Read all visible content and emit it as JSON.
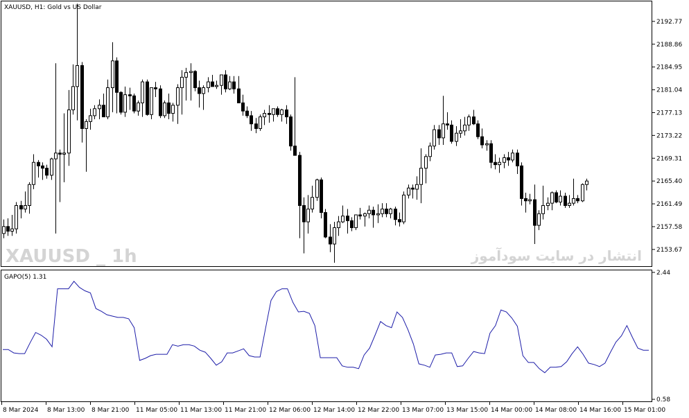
{
  "chart_data": [
    {
      "type": "candlestick",
      "title": "XAUUSD, H1:  Gold vs US Dollar",
      "watermark_left": "XAUUSD _ 1h",
      "watermark_right": "انتشار در سایت سودآموز",
      "ylim": [
        2150.8,
        2196.2
      ],
      "y_ticks": [
        "2192.77",
        "2188.86",
        "2184.95",
        "2181.04",
        "2177.13",
        "2173.22",
        "2169.31",
        "2165.40",
        "2161.49",
        "2157.58",
        "2153.67"
      ],
      "candles": [
        {
          "o": 2156.4,
          "h": 2158.8,
          "l": 2155.6,
          "c": 2157.6
        },
        {
          "o": 2157.6,
          "h": 2159.0,
          "l": 2156.0,
          "c": 2156.8
        },
        {
          "o": 2156.8,
          "h": 2159.6,
          "l": 2156.0,
          "c": 2157.2
        },
        {
          "o": 2157.2,
          "h": 2161.8,
          "l": 2156.4,
          "c": 2161.2
        },
        {
          "o": 2161.2,
          "h": 2162.0,
          "l": 2159.0,
          "c": 2160.6
        },
        {
          "o": 2160.6,
          "h": 2163.6,
          "l": 2160.0,
          "c": 2161.2
        },
        {
          "o": 2161.2,
          "h": 2165.2,
          "l": 2159.8,
          "c": 2164.8
        },
        {
          "o": 2164.8,
          "h": 2170.0,
          "l": 2164.0,
          "c": 2168.6
        },
        {
          "o": 2168.6,
          "h": 2169.0,
          "l": 2166.0,
          "c": 2168.0
        },
        {
          "o": 2168.0,
          "h": 2168.6,
          "l": 2165.6,
          "c": 2167.6
        },
        {
          "o": 2167.6,
          "h": 2168.2,
          "l": 2165.8,
          "c": 2166.4
        },
        {
          "o": 2166.4,
          "h": 2169.4,
          "l": 2165.6,
          "c": 2169.2
        },
        {
          "o": 2169.2,
          "h": 2185.6,
          "l": 2156.4,
          "c": 2170.2
        },
        {
          "o": 2170.2,
          "h": 2170.8,
          "l": 2161.8,
          "c": 2170.0
        },
        {
          "o": 2170.0,
          "h": 2177.0,
          "l": 2165.2,
          "c": 2170.2
        },
        {
          "o": 2170.2,
          "h": 2181.0,
          "l": 2168.0,
          "c": 2177.6
        },
        {
          "o": 2177.6,
          "h": 2185.4,
          "l": 2176.8,
          "c": 2181.6
        },
        {
          "o": 2181.6,
          "h": 2195.8,
          "l": 2175.8,
          "c": 2185.2
        },
        {
          "o": 2185.2,
          "h": 2185.8,
          "l": 2172.0,
          "c": 2174.4
        },
        {
          "o": 2174.4,
          "h": 2176.0,
          "l": 2167.0,
          "c": 2175.6
        },
        {
          "o": 2175.6,
          "h": 2177.8,
          "l": 2174.2,
          "c": 2176.6
        },
        {
          "o": 2176.6,
          "h": 2178.4,
          "l": 2176.0,
          "c": 2177.8
        },
        {
          "o": 2177.8,
          "h": 2179.4,
          "l": 2176.0,
          "c": 2178.4
        },
        {
          "o": 2178.4,
          "h": 2180.4,
          "l": 2177.0,
          "c": 2176.4
        },
        {
          "o": 2176.4,
          "h": 2182.8,
          "l": 2176.0,
          "c": 2181.4
        },
        {
          "o": 2181.4,
          "h": 2189.2,
          "l": 2177.2,
          "c": 2186.0
        },
        {
          "o": 2186.0,
          "h": 2186.6,
          "l": 2177.0,
          "c": 2180.6
        },
        {
          "o": 2180.6,
          "h": 2180.8,
          "l": 2176.8,
          "c": 2177.2
        },
        {
          "o": 2177.2,
          "h": 2181.6,
          "l": 2176.4,
          "c": 2180.2
        },
        {
          "o": 2180.2,
          "h": 2181.4,
          "l": 2177.6,
          "c": 2180.0
        },
        {
          "o": 2180.0,
          "h": 2180.4,
          "l": 2177.0,
          "c": 2177.4
        },
        {
          "o": 2177.4,
          "h": 2179.2,
          "l": 2176.6,
          "c": 2178.8
        },
        {
          "o": 2178.8,
          "h": 2182.8,
          "l": 2176.4,
          "c": 2182.4
        },
        {
          "o": 2182.4,
          "h": 2182.8,
          "l": 2176.6,
          "c": 2176.8
        },
        {
          "o": 2176.8,
          "h": 2178.2,
          "l": 2176.0,
          "c": 2181.4
        },
        {
          "o": 2181.4,
          "h": 2182.4,
          "l": 2179.8,
          "c": 2181.2
        },
        {
          "o": 2181.2,
          "h": 2181.8,
          "l": 2176.2,
          "c": 2176.6
        },
        {
          "o": 2176.6,
          "h": 2179.2,
          "l": 2176.2,
          "c": 2178.8
        },
        {
          "o": 2178.8,
          "h": 2180.4,
          "l": 2176.0,
          "c": 2177.0
        },
        {
          "o": 2177.0,
          "h": 2178.8,
          "l": 2175.6,
          "c": 2178.4
        },
        {
          "o": 2178.4,
          "h": 2182.0,
          "l": 2175.2,
          "c": 2181.4
        },
        {
          "o": 2181.4,
          "h": 2184.4,
          "l": 2176.8,
          "c": 2183.2
        },
        {
          "o": 2183.2,
          "h": 2184.8,
          "l": 2179.2,
          "c": 2184.0
        },
        {
          "o": 2184.0,
          "h": 2185.6,
          "l": 2179.2,
          "c": 2184.2
        },
        {
          "o": 2184.2,
          "h": 2184.4,
          "l": 2180.8,
          "c": 2181.4
        },
        {
          "o": 2181.4,
          "h": 2182.6,
          "l": 2178.0,
          "c": 2180.4
        },
        {
          "o": 2180.4,
          "h": 2181.8,
          "l": 2177.6,
          "c": 2181.4
        },
        {
          "o": 2181.4,
          "h": 2183.2,
          "l": 2180.6,
          "c": 2182.4
        },
        {
          "o": 2182.4,
          "h": 2183.6,
          "l": 2181.6,
          "c": 2181.6
        },
        {
          "o": 2181.6,
          "h": 2182.6,
          "l": 2181.2,
          "c": 2181.8
        },
        {
          "o": 2181.8,
          "h": 2183.6,
          "l": 2180.2,
          "c": 2183.6
        },
        {
          "o": 2183.6,
          "h": 2184.4,
          "l": 2180.6,
          "c": 2181.2
        },
        {
          "o": 2181.2,
          "h": 2183.4,
          "l": 2181.0,
          "c": 2182.4
        },
        {
          "o": 2182.4,
          "h": 2183.4,
          "l": 2180.4,
          "c": 2181.2
        },
        {
          "o": 2181.2,
          "h": 2183.4,
          "l": 2179.8,
          "c": 2178.8
        },
        {
          "o": 2178.8,
          "h": 2180.2,
          "l": 2176.6,
          "c": 2177.4
        },
        {
          "o": 2177.4,
          "h": 2178.2,
          "l": 2176.2,
          "c": 2176.6
        },
        {
          "o": 2176.6,
          "h": 2177.4,
          "l": 2174.0,
          "c": 2175.2
        },
        {
          "o": 2175.2,
          "h": 2176.2,
          "l": 2173.6,
          "c": 2174.4
        },
        {
          "o": 2174.4,
          "h": 2176.8,
          "l": 2174.0,
          "c": 2176.4
        },
        {
          "o": 2176.4,
          "h": 2177.6,
          "l": 2175.0,
          "c": 2177.0
        },
        {
          "o": 2177.0,
          "h": 2178.4,
          "l": 2175.4,
          "c": 2176.8
        },
        {
          "o": 2176.8,
          "h": 2177.0,
          "l": 2175.6,
          "c": 2177.8
        },
        {
          "o": 2177.8,
          "h": 2178.2,
          "l": 2176.4,
          "c": 2176.8
        },
        {
          "o": 2176.8,
          "h": 2177.8,
          "l": 2175.6,
          "c": 2177.6
        },
        {
          "o": 2177.6,
          "h": 2178.4,
          "l": 2175.2,
          "c": 2176.4
        },
        {
          "o": 2176.4,
          "h": 2176.8,
          "l": 2170.6,
          "c": 2171.4
        },
        {
          "o": 2171.4,
          "h": 2183.2,
          "l": 2170.8,
          "c": 2169.8
        },
        {
          "o": 2169.8,
          "h": 2170.4,
          "l": 2155.6,
          "c": 2161.2
        },
        {
          "o": 2161.2,
          "h": 2162.6,
          "l": 2153.0,
          "c": 2158.4
        },
        {
          "o": 2158.4,
          "h": 2163.0,
          "l": 2156.4,
          "c": 2160.6
        },
        {
          "o": 2160.6,
          "h": 2164.6,
          "l": 2160.0,
          "c": 2162.6
        },
        {
          "o": 2162.6,
          "h": 2165.8,
          "l": 2162.0,
          "c": 2165.6
        },
        {
          "o": 2165.6,
          "h": 2166.0,
          "l": 2159.0,
          "c": 2160.0
        },
        {
          "o": 2160.0,
          "h": 2160.6,
          "l": 2155.6,
          "c": 2155.8
        },
        {
          "o": 2155.8,
          "h": 2158.0,
          "l": 2153.2,
          "c": 2154.6
        },
        {
          "o": 2154.6,
          "h": 2158.4,
          "l": 2151.4,
          "c": 2157.4
        },
        {
          "o": 2157.4,
          "h": 2159.4,
          "l": 2156.0,
          "c": 2158.4
        },
        {
          "o": 2158.4,
          "h": 2161.2,
          "l": 2158.2,
          "c": 2159.4
        },
        {
          "o": 2159.4,
          "h": 2160.6,
          "l": 2156.4,
          "c": 2158.6
        },
        {
          "o": 2158.6,
          "h": 2159.2,
          "l": 2156.8,
          "c": 2157.4
        },
        {
          "o": 2157.4,
          "h": 2158.6,
          "l": 2157.0,
          "c": 2159.6
        },
        {
          "o": 2159.6,
          "h": 2160.8,
          "l": 2158.8,
          "c": 2159.4
        },
        {
          "o": 2159.4,
          "h": 2160.0,
          "l": 2157.6,
          "c": 2159.8
        },
        {
          "o": 2159.8,
          "h": 2161.2,
          "l": 2159.0,
          "c": 2160.4
        },
        {
          "o": 2160.4,
          "h": 2161.0,
          "l": 2157.4,
          "c": 2159.6
        },
        {
          "o": 2159.6,
          "h": 2161.4,
          "l": 2158.2,
          "c": 2159.8
        },
        {
          "o": 2159.8,
          "h": 2161.6,
          "l": 2159.2,
          "c": 2160.6
        },
        {
          "o": 2160.6,
          "h": 2161.6,
          "l": 2159.2,
          "c": 2159.8
        },
        {
          "o": 2159.8,
          "h": 2160.8,
          "l": 2159.0,
          "c": 2160.6
        },
        {
          "o": 2160.6,
          "h": 2161.0,
          "l": 2157.8,
          "c": 2158.8
        },
        {
          "o": 2158.8,
          "h": 2160.0,
          "l": 2157.6,
          "c": 2158.4
        },
        {
          "o": 2158.4,
          "h": 2163.6,
          "l": 2158.0,
          "c": 2163.0
        },
        {
          "o": 2163.0,
          "h": 2164.8,
          "l": 2162.4,
          "c": 2164.2
        },
        {
          "o": 2164.2,
          "h": 2164.8,
          "l": 2162.4,
          "c": 2164.0
        },
        {
          "o": 2164.0,
          "h": 2166.2,
          "l": 2162.2,
          "c": 2164.8
        },
        {
          "o": 2164.8,
          "h": 2171.0,
          "l": 2161.6,
          "c": 2167.6
        },
        {
          "o": 2167.6,
          "h": 2170.0,
          "l": 2165.0,
          "c": 2169.6
        },
        {
          "o": 2169.6,
          "h": 2172.0,
          "l": 2168.8,
          "c": 2171.4
        },
        {
          "o": 2171.4,
          "h": 2175.0,
          "l": 2170.8,
          "c": 2174.2
        },
        {
          "o": 2174.2,
          "h": 2175.0,
          "l": 2171.6,
          "c": 2172.8
        },
        {
          "o": 2172.8,
          "h": 2180.0,
          "l": 2171.6,
          "c": 2175.2
        },
        {
          "o": 2175.2,
          "h": 2177.2,
          "l": 2174.2,
          "c": 2175.0
        },
        {
          "o": 2175.0,
          "h": 2175.8,
          "l": 2171.8,
          "c": 2172.2
        },
        {
          "o": 2172.2,
          "h": 2174.8,
          "l": 2171.4,
          "c": 2173.6
        },
        {
          "o": 2173.6,
          "h": 2176.0,
          "l": 2172.8,
          "c": 2174.0
        },
        {
          "o": 2174.0,
          "h": 2176.4,
          "l": 2173.2,
          "c": 2175.0
        },
        {
          "o": 2175.0,
          "h": 2176.8,
          "l": 2174.0,
          "c": 2176.4
        },
        {
          "o": 2176.4,
          "h": 2177.6,
          "l": 2175.0,
          "c": 2175.2
        },
        {
          "o": 2175.2,
          "h": 2175.8,
          "l": 2172.6,
          "c": 2173.0
        },
        {
          "o": 2173.0,
          "h": 2174.4,
          "l": 2171.0,
          "c": 2171.6
        },
        {
          "o": 2171.6,
          "h": 2172.4,
          "l": 2170.6,
          "c": 2171.8
        },
        {
          "o": 2171.8,
          "h": 2172.4,
          "l": 2167.6,
          "c": 2168.6
        },
        {
          "o": 2168.6,
          "h": 2170.0,
          "l": 2167.4,
          "c": 2168.2
        },
        {
          "o": 2168.2,
          "h": 2169.4,
          "l": 2166.8,
          "c": 2168.6
        },
        {
          "o": 2168.6,
          "h": 2170.0,
          "l": 2167.6,
          "c": 2169.4
        },
        {
          "o": 2169.4,
          "h": 2170.4,
          "l": 2168.0,
          "c": 2169.0
        },
        {
          "o": 2169.0,
          "h": 2170.8,
          "l": 2168.6,
          "c": 2170.2
        },
        {
          "o": 2170.2,
          "h": 2170.8,
          "l": 2166.6,
          "c": 2168.0
        },
        {
          "o": 2168.0,
          "h": 2168.6,
          "l": 2161.2,
          "c": 2162.4
        },
        {
          "o": 2162.4,
          "h": 2163.4,
          "l": 2160.0,
          "c": 2162.0
        },
        {
          "o": 2162.0,
          "h": 2163.2,
          "l": 2161.4,
          "c": 2162.2
        },
        {
          "o": 2162.2,
          "h": 2164.8,
          "l": 2154.6,
          "c": 2157.8
        },
        {
          "o": 2157.8,
          "h": 2160.4,
          "l": 2157.0,
          "c": 2159.8
        },
        {
          "o": 2159.8,
          "h": 2164.6,
          "l": 2158.8,
          "c": 2161.2
        },
        {
          "o": 2161.2,
          "h": 2162.6,
          "l": 2160.4,
          "c": 2161.6
        },
        {
          "o": 2161.6,
          "h": 2163.6,
          "l": 2160.4,
          "c": 2163.4
        },
        {
          "o": 2163.4,
          "h": 2163.8,
          "l": 2161.6,
          "c": 2161.8
        },
        {
          "o": 2161.8,
          "h": 2163.8,
          "l": 2161.2,
          "c": 2162.8
        },
        {
          "o": 2162.8,
          "h": 2163.4,
          "l": 2160.8,
          "c": 2161.2
        },
        {
          "o": 2161.2,
          "h": 2163.0,
          "l": 2160.8,
          "c": 2161.6
        },
        {
          "o": 2161.6,
          "h": 2165.8,
          "l": 2161.2,
          "c": 2162.4
        },
        {
          "o": 2162.4,
          "h": 2163.0,
          "l": 2161.6,
          "c": 2162.0
        },
        {
          "o": 2162.0,
          "h": 2165.0,
          "l": 2161.8,
          "c": 2164.8
        },
        {
          "o": 2164.8,
          "h": 2165.8,
          "l": 2163.8,
          "c": 2165.4
        }
      ]
    },
    {
      "type": "line",
      "label": "GAPO(5) 1.31",
      "ylim": [
        0.55,
        2.47
      ],
      "y_ticks": [
        "2.44",
        "0.58"
      ],
      "line_color": "#1c1ca8",
      "values": [
        1.31,
        1.31,
        1.26,
        1.25,
        1.25,
        1.41,
        1.56,
        1.52,
        1.46,
        1.35,
        2.2,
        2.2,
        2.2,
        2.31,
        2.22,
        2.17,
        2.14,
        1.91,
        1.87,
        1.82,
        1.8,
        1.78,
        1.78,
        1.76,
        1.63,
        1.15,
        1.18,
        1.22,
        1.24,
        1.24,
        1.24,
        1.38,
        1.36,
        1.38,
        1.38,
        1.36,
        1.3,
        1.27,
        1.18,
        1.08,
        1.13,
        1.26,
        1.26,
        1.29,
        1.32,
        1.22,
        1.2,
        1.2,
        1.62,
        2.03,
        2.16,
        2.2,
        2.2,
        2.0,
        1.86,
        1.87,
        1.84,
        1.66,
        1.19,
        1.19,
        1.19,
        1.19,
        1.07,
        1.05,
        1.05,
        1.03,
        1.23,
        1.33,
        1.52,
        1.72,
        1.66,
        1.63,
        1.86,
        1.78,
        1.6,
        1.39,
        1.1,
        1.08,
        1.05,
        1.23,
        1.24,
        1.26,
        1.26,
        1.06,
        1.07,
        1.18,
        1.28,
        1.26,
        1.25,
        1.55,
        1.66,
        1.89,
        1.86,
        1.77,
        1.65,
        1.22,
        1.12,
        1.12,
        1.03,
        0.97,
        1.05,
        1.05,
        1.06,
        1.13,
        1.25,
        1.35,
        1.24,
        1.11,
        1.09,
        1.06,
        1.11,
        1.27,
        1.42,
        1.51,
        1.66,
        1.49,
        1.33,
        1.3,
        1.3
      ]
    }
  ],
  "x_labels": [
    "8 Mar 2024",
    "8 Mar 13:00",
    "8 Mar 21:00",
    "11 Mar 05:00",
    "11 Mar 13:00",
    "11 Mar 21:00",
    "12 Mar 06:00",
    "12 Mar 14:00",
    "12 Mar 22:00",
    "13 Mar 07:00",
    "13 Mar 15:00",
    "14 Mar 00:00",
    "14 Mar 08:00",
    "14 Mar 16:00",
    "15 Mar 01:00"
  ],
  "colors": {
    "candle": "#000000",
    "background": "#ffffff",
    "watermark": "#d4d4d4"
  }
}
